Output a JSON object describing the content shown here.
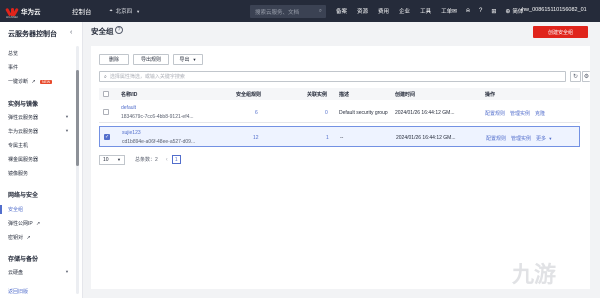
{
  "topbar": {
    "brand": "华为云",
    "brand_sub": "HUAWEI",
    "console": "控制台",
    "region": "北京四",
    "search_placeholder": "搜索云服务、文档",
    "nav": [
      "备案",
      "资源",
      "费用",
      "企业",
      "工具",
      "工单"
    ],
    "icons": [
      "mail-icon",
      "bell-icon",
      "help-icon",
      "cart-icon"
    ],
    "lang": "简体",
    "user": "hw_008615110156082_01"
  },
  "sidebar": {
    "title": "云服务器控制台",
    "items_top": [
      "总览",
      "事件",
      "一键诊断"
    ],
    "new_badge": "NEW",
    "group_image": "实例与镜像",
    "items_image": [
      "弹性云服务器",
      "华为云服务器",
      "专属主机",
      "裸金属服务器",
      "镜像服务"
    ],
    "group_network": "网络与安全",
    "items_network": [
      "安全组",
      "弹性公网IP",
      "密钥对"
    ],
    "group_storage": "存储与备份",
    "items_storage": [
      "云硬盘"
    ],
    "bottom": "返回旧版"
  },
  "page": {
    "title": "安全组",
    "create_button": "创建安全组"
  },
  "toolbar": {
    "delete": "删除",
    "export_rules": "导出规则",
    "export": "导出",
    "filter_placeholder": "选择属性筛选，或输入关键字搜索"
  },
  "table": {
    "columns": [
      "名称/ID",
      "安全组规则",
      "关联实例",
      "描述",
      "创建时间",
      "操作"
    ],
    "rows": [
      {
        "name": "default",
        "id": "1834679c-7cc6-4bb8-9121-ef4...",
        "rules": "6",
        "instances": "0",
        "description": "Default security group",
        "created": "2024/01/26 16:44:12 GM...",
        "actions": [
          "配置规则",
          "管理实例",
          "克隆"
        ]
      },
      {
        "name": "sujie123",
        "id": "cd1b894e-a06f-48ee-a527-d09...",
        "rules": "12",
        "instances": "1",
        "description": "--",
        "created": "2024/01/26 16:44:12 GM...",
        "actions": [
          "配置规则",
          "管理实例",
          "更多"
        ]
      }
    ]
  },
  "pagination": {
    "page_size": "10",
    "total": "总条数：2",
    "current": "1"
  },
  "watermark": "九游"
}
